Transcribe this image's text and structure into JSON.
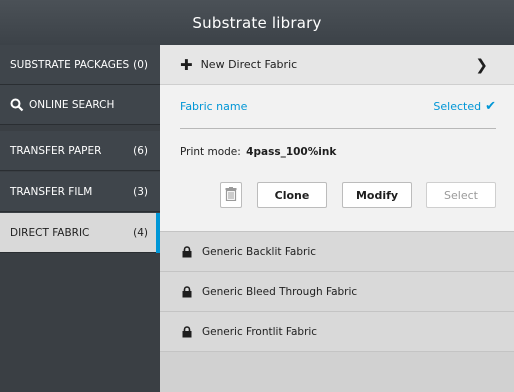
{
  "header": {
    "title": "Substrate library"
  },
  "sidebar": {
    "items": [
      {
        "label": "SUBSTRATE PACKAGES",
        "count": "(0)"
      },
      {
        "label": "ONLINE SEARCH",
        "count": "",
        "icon": "search-icon"
      },
      {
        "label": "TRANSFER PAPER",
        "count": "(6)"
      },
      {
        "label": "TRANSFER FILM",
        "count": "(3)"
      },
      {
        "label": "DIRECT FABRIC",
        "count": "(4)",
        "active": true
      }
    ]
  },
  "main": {
    "new_item": {
      "label": "New Direct Fabric",
      "icon": "plus-icon",
      "chevron": "chevron-right-icon"
    },
    "field": {
      "name_label": "Fabric name",
      "selected_label": "Selected"
    },
    "print_mode": {
      "label": "Print mode:",
      "value": "4pass_100%ink"
    },
    "buttons": {
      "delete_icon": "trash-icon",
      "clone": "Clone",
      "modify": "Modify",
      "select": "Select"
    },
    "fabrics": [
      {
        "name": "Generic Backlit Fabric",
        "icon": "lock-icon"
      },
      {
        "name": "Generic Bleed Through Fabric",
        "icon": "lock-icon"
      },
      {
        "name": "Generic Frontlit Fabric",
        "icon": "lock-icon"
      }
    ]
  },
  "colors": {
    "accent": "#0096d6",
    "sidebar": "#3f454b",
    "active_item": "#d9d9d9"
  }
}
